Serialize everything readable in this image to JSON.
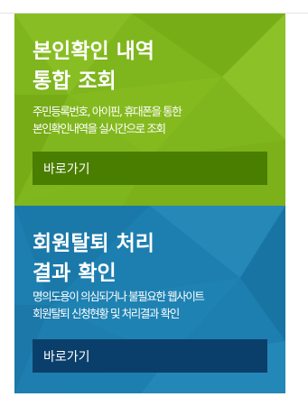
{
  "panels": [
    {
      "title": "본인확인 내역\n통합 조회",
      "description": "주민등록번호, 아이핀, 휴대폰을 통한\n본인확인내역을 실시간으로 조회",
      "button_label": "바로가기",
      "colors": {
        "background": "#7fb51d",
        "button": "#4a7e00"
      }
    },
    {
      "title": "회원탈퇴 처리\n결과 확인",
      "description": "명의도용이 의심되거나 불필요한 웹사이트\n회원탈퇴 신청현황 및 처리결과 확인",
      "button_label": "바로가기",
      "colors": {
        "background": "#1d7fb0",
        "button": "#0b3f6b"
      }
    }
  ]
}
